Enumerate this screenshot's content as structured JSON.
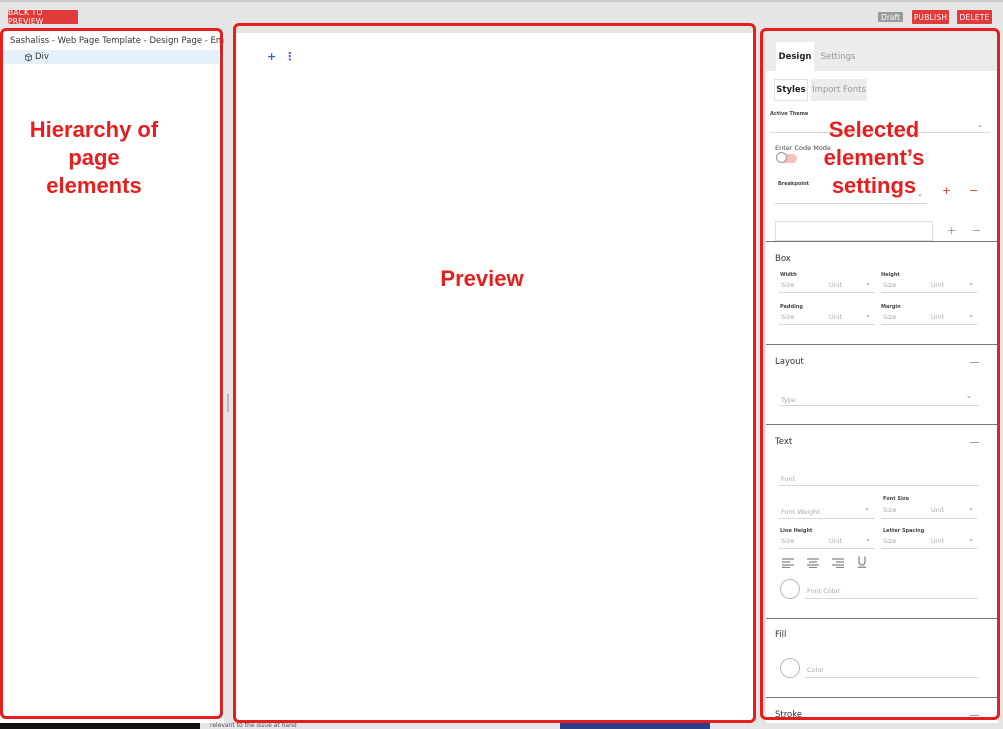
{
  "toolbar": {
    "back_label": "BACK TO PREVIEW",
    "draft_label": "Draft",
    "publish_label": "PUBLISH",
    "delete_label": "DELETE"
  },
  "tree": {
    "root_label": "Sashaliss - Web Page Template - Design Page - Emc",
    "child_label": "Div"
  },
  "preview": {
    "add_symbol": "+",
    "more_symbol": "⋮"
  },
  "settings": {
    "tabs": [
      "Design",
      "Settings"
    ],
    "subtabs": [
      "Styles",
      "Import Fonts"
    ],
    "active_theme_label": "Active Theme",
    "code_mode_label": "Enter Code Mode",
    "breakpoint_label": "Breakpoint",
    "plus": "+",
    "minus": "−",
    "box": {
      "title": "Box",
      "width_label": "Width",
      "height_label": "Height",
      "padding_label": "Padding",
      "margin_label": "Margin",
      "size_placeholder": "Size",
      "unit_placeholder": "Unit"
    },
    "layout": {
      "title": "Layout",
      "type_placeholder": "Type"
    },
    "text": {
      "title": "Text",
      "font_placeholder": "Font",
      "font_weight_placeholder": "Font Weight",
      "font_size_label": "Font Size",
      "line_height_label": "Line Height",
      "letter_spacing_label": "Letter Spacing",
      "size_placeholder": "Size",
      "unit_placeholder": "Unit",
      "font_color_placeholder": "Font Color"
    },
    "fill": {
      "title": "Fill",
      "color_placeholder": "Color"
    },
    "stroke": {
      "title": "Stroke"
    }
  },
  "annotations": {
    "left": "Hierarchy of\npage\nelements",
    "center": "Preview",
    "right": "Selected\nelement’s\nsettings"
  },
  "background_text": "relevant to the issue at hand",
  "colors": {
    "accent_red": "#e03a3a",
    "annotation_red": "#e81e1e",
    "link_blue": "#3b5ccc",
    "selection_blue": "#e6f0fa"
  }
}
